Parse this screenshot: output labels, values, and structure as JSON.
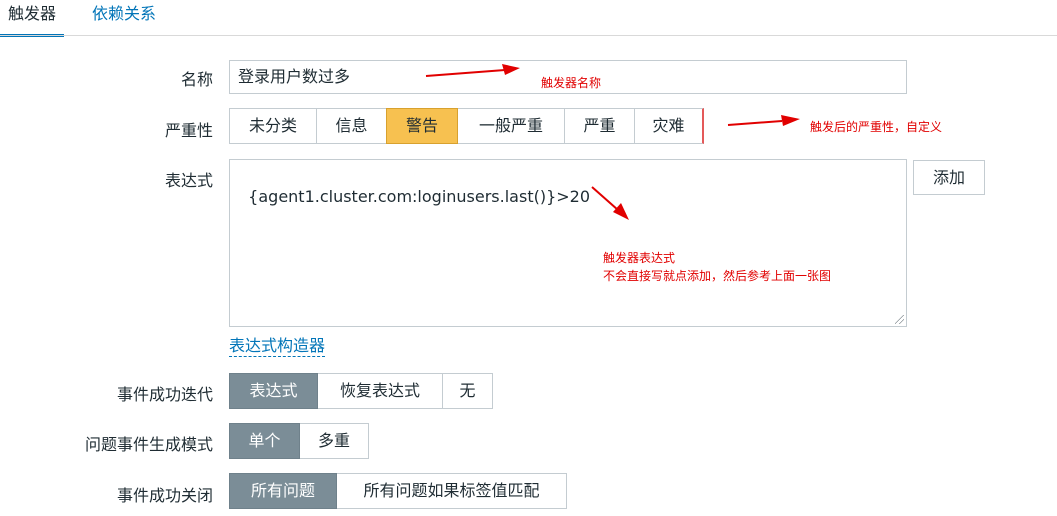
{
  "tabs": [
    {
      "label": "触发器",
      "active": true
    },
    {
      "label": "依赖关系",
      "active": false
    }
  ],
  "form": {
    "name_label": "名称",
    "name_value": "登录用户数过多",
    "severity_label": "严重性",
    "severity_options": [
      "未分类",
      "信息",
      "警告",
      "一般严重",
      "严重",
      "灾难"
    ],
    "severity_selected": "警告",
    "expression_label": "表达式",
    "expression_value": "{agent1.cluster.com:loginusers.last()}>20",
    "add_button": "添加",
    "expression_builder_link": "表达式构造器",
    "ok_event_generation_label": "事件成功迭代",
    "ok_event_generation_options": [
      "表达式",
      "恢复表达式",
      "无"
    ],
    "ok_event_generation_selected": "表达式",
    "problem_event_mode_label": "问题事件生成模式",
    "problem_event_mode_options": [
      "单个",
      "多重"
    ],
    "problem_event_mode_selected": "单个",
    "ok_event_closes_label": "事件成功关闭",
    "ok_event_closes_options": [
      "所有问题",
      "所有问题如果标签值匹配"
    ],
    "ok_event_closes_selected": "所有问题"
  },
  "annotations": {
    "name_note": "触发器名称",
    "severity_note": "触发后的严重性，自定义",
    "expression_note_line1": "触发器表达式",
    "expression_note_line2": "不会直接写就点添加，然后参考上面一张图"
  },
  "colors": {
    "link": "#0275b8",
    "selected_severity": "#f7c150",
    "selected_option": "#7b8d97",
    "annotation": "#e10000",
    "disaster_border": "#e45959"
  }
}
